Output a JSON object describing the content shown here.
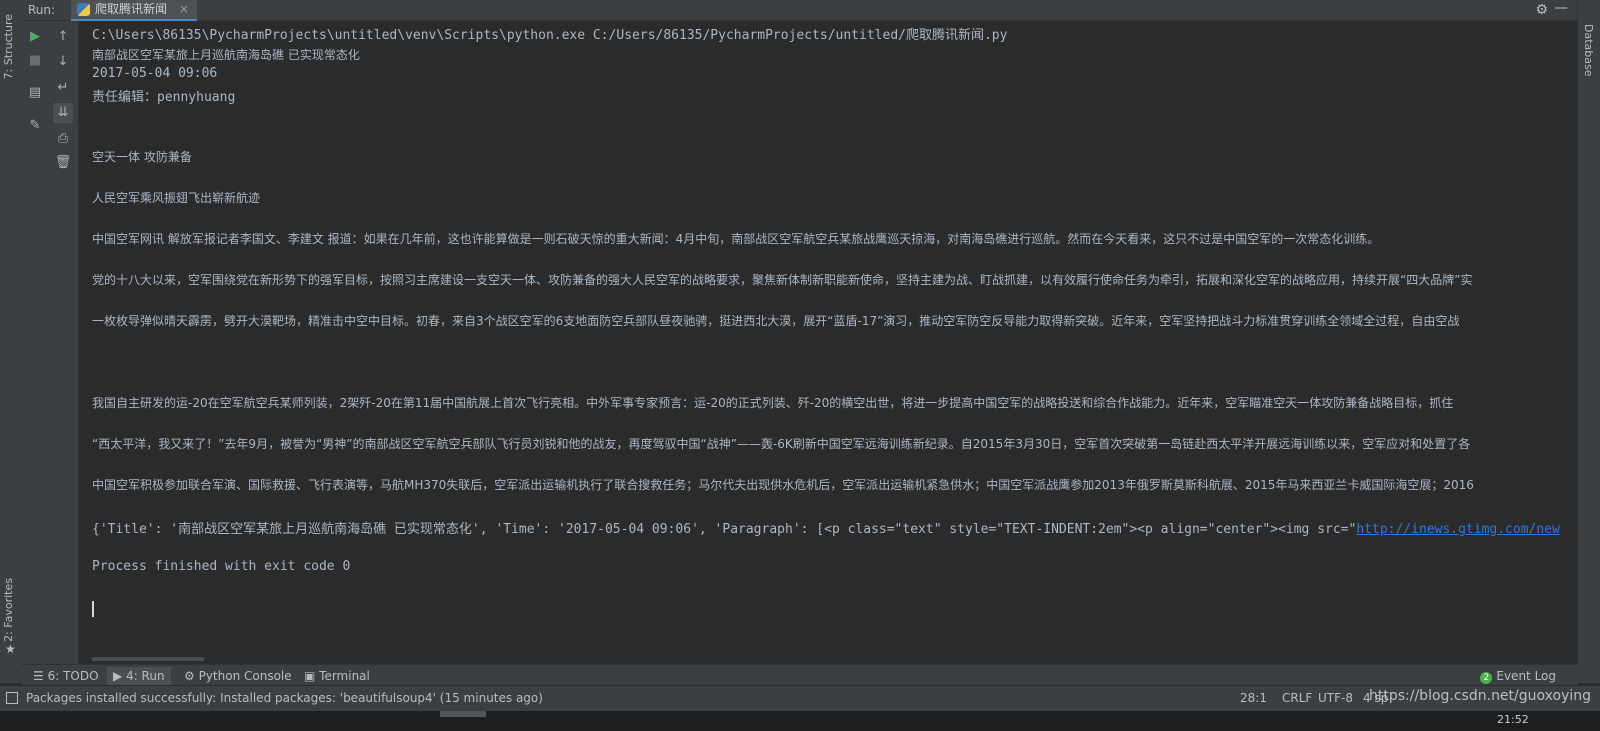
{
  "left_strip": {
    "structure_tab": "7: Structure",
    "favorites_tab": "2: Favorites"
  },
  "header": {
    "run_label": "Run:",
    "tab_title": "爬取腾讯新闻",
    "close": "×"
  },
  "right_strip": {
    "database_tab": "Database"
  },
  "console": {
    "lines": [
      "C:\\Users\\86135\\PycharmProjects\\untitled\\venv\\Scripts\\python.exe C:/Users/86135/PycharmProjects/untitled/爬取腾讯新闻.py",
      "南部战区空军某旅上月巡航南海岛礁 已实现常态化",
      "2017-05-04 09:06",
      "责任编辑：pennyhuang",
      "空天一体 攻防兼备",
      "人民空军乘风振翅飞出崭新航迹",
      "中国空军网讯 解放军报记者李国文、李建文 报道：如果在几年前，这也许能算做是一则石破天惊的重大新闻：4月中旬，南部战区空军航空兵某旅战鹰巡天掠海，对南海岛礁进行巡航。然而在今天看来，这只不过是中国空军的一次常态化训练。",
      "党的十八大以来，空军围绕党在新形势下的强军目标，按照习主席建设一支空天一体、攻防兼备的强大人民空军的战略要求，聚焦新体制新职能新使命，坚持主建为战、盯战抓建，以有效履行使命任务为牵引，拓展和深化空军的战略应用，持续开展“四大品牌”实",
      "一枚枚导弹似晴天霹雳，劈开大漠靶场，精准击中空中目标。初春，来自3个战区空军的6支地面防空兵部队昼夜驰骋，挺进西北大漠，展开“蓝盾-17”演习，推动空军防空反导能力取得新突破。近年来，空军坚持把战斗力标准贯穿训练全领域全过程，自由空战",
      "我国自主研发的运-20在空军航空兵某师列装，2架歼-20在第11届中国航展上首次飞行亮相。中外军事专家预言：运-20的正式列装、歼-20的横空出世，将进一步提高中国空军的战略投送和综合作战能力。近年来，空军瞄准空天一体攻防兼备战略目标，抓住",
      "“西太平洋，我又来了！”去年9月，被誉为“男神”的南部战区空军航空兵部队飞行员刘锐和他的战友，再度驾驭中国“战神”——轰-6K刷新中国空军远海训练新纪录。自2015年3月30日，空军首次突破第一岛链赴西太平洋开展远海训练以来，空军应对和处置了各",
      "中国空军积极参加联合军演、国际救援、飞行表演等，马航MH370失联后，空军派出运输机执行了联合搜救任务；马尔代夫出现供水危机后，空军派出运输机紧急供水；中国空军派战鹰参加2013年俄罗斯莫斯科航展、2015年马来西亚兰卡威国际海空展；2016",
      "{'Title': '南部战区空军某旅上月巡航南海岛礁 已实现常态化', 'Time': '2017-05-04 09:06', 'Paragraph': [<p class=\"text\" style=\"TEXT-INDENT:2em\"><p align=\"center\"><img src=\"",
      "http://inews.gtimg.com/new",
      "Process finished with exit code 0"
    ]
  },
  "bottom_tabs": {
    "todo": "6: TODO",
    "run": "4: Run",
    "python_console": "Python Console",
    "terminal": "Terminal",
    "event_log_count": "2",
    "event_log": "Event Log"
  },
  "status_bar": {
    "message": "Packages installed successfully: Installed packages: 'beautifulsoup4' (15 minutes ago)",
    "position": "28:1",
    "line_sep": "CRLF",
    "encoding": "UTF-8",
    "indent": "4 sp",
    "watermark": "https://blog.csdn.net/guoxoying",
    "clock": "21:52"
  },
  "colors": {
    "bg": "#2b2b2b",
    "panel": "#3c3f41",
    "text": "#a9b7c6",
    "link": "#287bde"
  }
}
